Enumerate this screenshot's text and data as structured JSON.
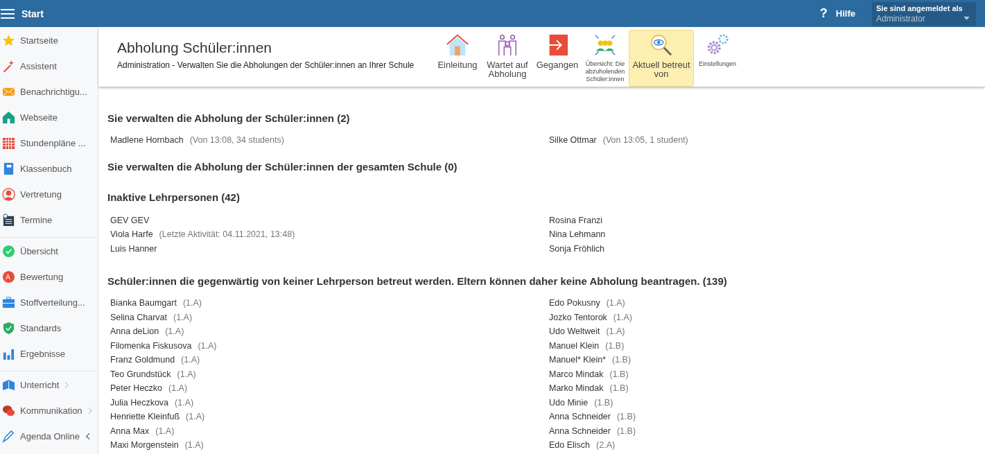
{
  "topbar": {
    "title": "Start",
    "help_icon": "?",
    "help": "Hilfe",
    "login_label": "Sie sind angemeldet als",
    "login_user": "Administrator"
  },
  "sidebar": {
    "groups": [
      [
        {
          "kind": "star",
          "label": "Startseite"
        },
        {
          "kind": "wand",
          "label": "Assistent"
        },
        {
          "kind": "mail",
          "label": "Benachrichtigu..."
        },
        {
          "kind": "house",
          "label": "Webseite"
        },
        {
          "kind": "grid",
          "label": "Stundenpläne ..."
        },
        {
          "kind": "book",
          "label": "Klassenbuch"
        },
        {
          "kind": "person",
          "label": "Vertretung"
        },
        {
          "kind": "calendar",
          "label": "Termine"
        }
      ],
      [
        {
          "kind": "check",
          "label": "Übersicht"
        },
        {
          "kind": "grade",
          "label": "Bewertung"
        },
        {
          "kind": "case",
          "label": "Stoffverteilung..."
        },
        {
          "kind": "shield",
          "label": "Standards"
        },
        {
          "kind": "bars",
          "label": "Ergebnisse"
        }
      ],
      [
        {
          "kind": "openbook",
          "label": "Unterricht",
          "has_submenu": true
        },
        {
          "kind": "chat",
          "label": "Kommunikation",
          "has_submenu": true
        },
        {
          "kind": "pen",
          "label": "Agenda Online",
          "has_submenu": false
        }
      ]
    ]
  },
  "header": {
    "title": "Abholung Schüler:innen",
    "subtitle": "Administration - Verwalten Sie die Abholungen der Schüler:innen an Ihrer Schule",
    "tools": [
      {
        "kind": "house",
        "label": "Einleitung",
        "small": false,
        "selected": false
      },
      {
        "kind": "family",
        "label": "Wartet auf Abholung",
        "small": false,
        "selected": false
      },
      {
        "kind": "exit",
        "label": "Gegangen",
        "small": false,
        "selected": false
      },
      {
        "kind": "group",
        "label": "Übersicht: Die abzuholenden Schüler:innen",
        "small": true,
        "selected": false
      },
      {
        "kind": "magnifier",
        "label": "Aktuell betreut von",
        "small": false,
        "selected": true
      },
      {
        "kind": "gears",
        "label": "Einstellungen",
        "small": true,
        "selected": false
      }
    ]
  },
  "sections": [
    {
      "title": "Sie verwalten die Abholung der Schüler:innen (2)",
      "columns": [
        [
          {
            "name": "Madlene Hornbach",
            "note": "(Von 13:08, 34 students)"
          }
        ],
        [
          {
            "name": "Silke Ottmar",
            "note": "(Von 13:05, 1 student)"
          }
        ]
      ]
    },
    {
      "title": "Sie verwalten die Abholung der Schüler:innen der gesamten Schule (0)"
    },
    {
      "title": "Inaktive Lehrpersonen (42)",
      "columns": [
        [
          {
            "name": "GEV GEV"
          },
          {
            "name": "Viola Harfe",
            "note": "(Letzte Aktivität: 04.11.2021, 13:48)"
          },
          {
            "name": "Luis Hanner"
          }
        ],
        [
          {
            "name": "Rosina Franzi"
          },
          {
            "name": "Nina Lehmann"
          },
          {
            "name": "Sonja Fröhlich"
          }
        ]
      ]
    },
    {
      "title": "Schüler:innen die gegenwärtig von keiner Lehrperson betreut werden. Eltern können daher keine Abholung beantragen. (139)",
      "columns": [
        [
          {
            "name": "Bianka Baumgart",
            "note": "(1.A)"
          },
          {
            "name": "Selina Charvat",
            "note": "(1.A)"
          },
          {
            "name": "Anna deLion",
            "note": "(1.A)"
          },
          {
            "name": "Filomenka Fiskusova",
            "note": "(1.A)"
          },
          {
            "name": "Franz Goldmund",
            "note": "(1.A)"
          },
          {
            "name": "Teo Grundstück",
            "note": "(1.A)"
          },
          {
            "name": "Peter Heczko",
            "note": "(1.A)"
          },
          {
            "name": "Julia Heczkova",
            "note": "(1.A)"
          },
          {
            "name": "Henriette Kleinfuß",
            "note": "(1.A)"
          },
          {
            "name": "Anna Max",
            "note": "(1.A)"
          },
          {
            "name": "Maxi Morgenstein",
            "note": "(1.A)"
          }
        ],
        [
          {
            "name": "Edo Pokusny",
            "note": "(1.A)"
          },
          {
            "name": "Jozko Tentorok",
            "note": "(1.A)"
          },
          {
            "name": "Udo Weltweit",
            "note": "(1.A)"
          },
          {
            "name": "Manuel Klein",
            "note": "(1.B)"
          },
          {
            "name": "Manuel* Klein*",
            "note": "(1.B)"
          },
          {
            "name": "Marco Mindak",
            "note": "(1.B)"
          },
          {
            "name": "Marko Mindak",
            "note": "(1.B)"
          },
          {
            "name": "Udo Minie",
            "note": "(1.B)"
          },
          {
            "name": "Anna Schneider",
            "note": "(1.B)"
          },
          {
            "name": "Anna Schneider",
            "note": "(1.B)"
          },
          {
            "name": "Edo Elisch",
            "note": "(2.A)"
          }
        ]
      ]
    }
  ]
}
